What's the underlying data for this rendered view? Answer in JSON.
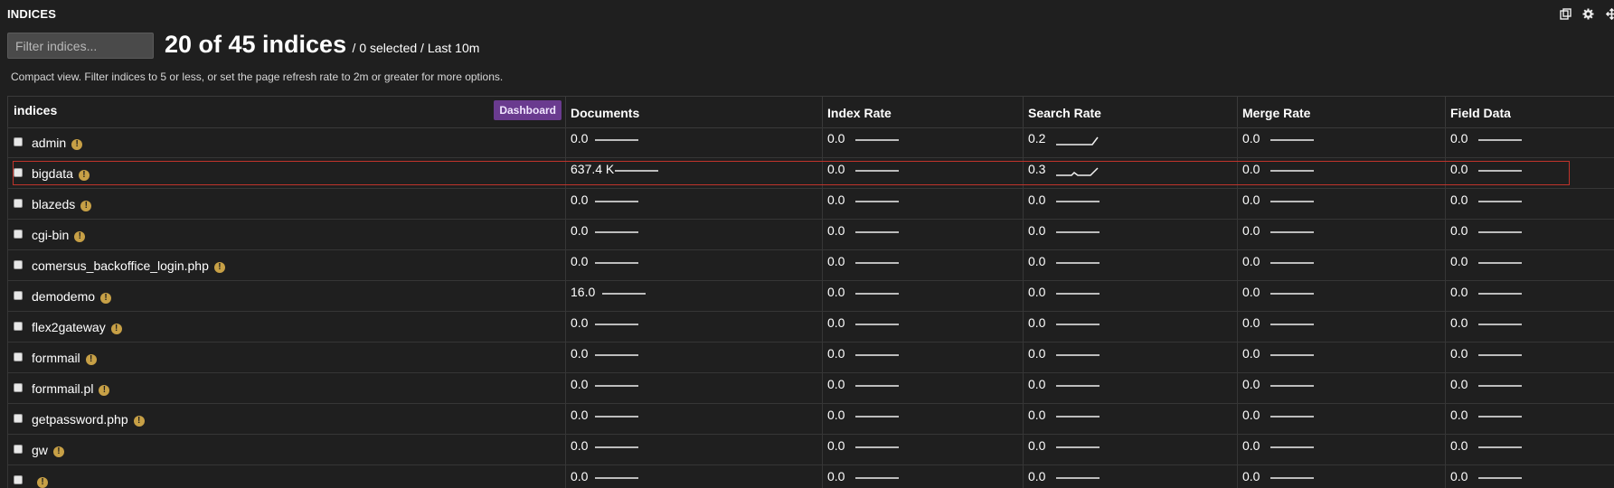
{
  "header": {
    "title": "INDICES",
    "icons": [
      "copy-icon",
      "gear-icon",
      "expand-icon"
    ]
  },
  "filter": {
    "placeholder": "Filter indices..."
  },
  "summary": {
    "count_text": "20 of 45 indices",
    "detail_text": "/ 0 selected / Last 10m"
  },
  "note": "Compact view. Filter indices to 5 or less, or set the page refresh rate to 2m or greater for more options.",
  "table": {
    "columns": [
      "indices",
      "Documents",
      "Index Rate",
      "Search Rate",
      "Merge Rate",
      "Field Data"
    ],
    "dashboard_label": "Dashboard",
    "rows": [
      {
        "name": "admin",
        "documents": "0.0",
        "index_rate": "0.0",
        "search_rate": "0.2",
        "merge_rate": "0.0",
        "field_data": "0.0",
        "search_spark": "rise_end"
      },
      {
        "name": "bigdata",
        "documents": "637.4 K",
        "index_rate": "0.0",
        "search_rate": "0.3",
        "merge_rate": "0.0",
        "field_data": "0.0",
        "search_spark": "blip_rise"
      },
      {
        "name": "blazeds",
        "documents": "0.0",
        "index_rate": "0.0",
        "search_rate": "0.0",
        "merge_rate": "0.0",
        "field_data": "0.0",
        "search_spark": "flat"
      },
      {
        "name": "cgi-bin",
        "documents": "0.0",
        "index_rate": "0.0",
        "search_rate": "0.0",
        "merge_rate": "0.0",
        "field_data": "0.0",
        "search_spark": "flat"
      },
      {
        "name": "comersus_backoffice_login.php",
        "documents": "0.0",
        "index_rate": "0.0",
        "search_rate": "0.0",
        "merge_rate": "0.0",
        "field_data": "0.0",
        "search_spark": "flat"
      },
      {
        "name": "demodemo",
        "documents": "16.0",
        "index_rate": "0.0",
        "search_rate": "0.0",
        "merge_rate": "0.0",
        "field_data": "0.0",
        "search_spark": "flat"
      },
      {
        "name": "flex2gateway",
        "documents": "0.0",
        "index_rate": "0.0",
        "search_rate": "0.0",
        "merge_rate": "0.0",
        "field_data": "0.0",
        "search_spark": "flat"
      },
      {
        "name": "formmail",
        "documents": "0.0",
        "index_rate": "0.0",
        "search_rate": "0.0",
        "merge_rate": "0.0",
        "field_data": "0.0",
        "search_spark": "flat"
      },
      {
        "name": "formmail.pl",
        "documents": "0.0",
        "index_rate": "0.0",
        "search_rate": "0.0",
        "merge_rate": "0.0",
        "field_data": "0.0",
        "search_spark": "flat"
      },
      {
        "name": "getpassword.php",
        "documents": "0.0",
        "index_rate": "0.0",
        "search_rate": "0.0",
        "merge_rate": "0.0",
        "field_data": "0.0",
        "search_spark": "flat"
      },
      {
        "name": "gw",
        "documents": "0.0",
        "index_rate": "0.0",
        "search_rate": "0.0",
        "merge_rate": "0.0",
        "field_data": "0.0",
        "search_spark": "flat"
      },
      {
        "name": "",
        "documents": "0.0",
        "index_rate": "0.0",
        "search_rate": "0.0",
        "merge_rate": "0.0",
        "field_data": "0.0",
        "search_spark": "flat"
      }
    ]
  },
  "colors": {
    "background": "#1f1f1f",
    "dashboard_button": "#6a3b8f",
    "warning_icon": "#c7a046",
    "highlight_border": "#c0342b"
  }
}
